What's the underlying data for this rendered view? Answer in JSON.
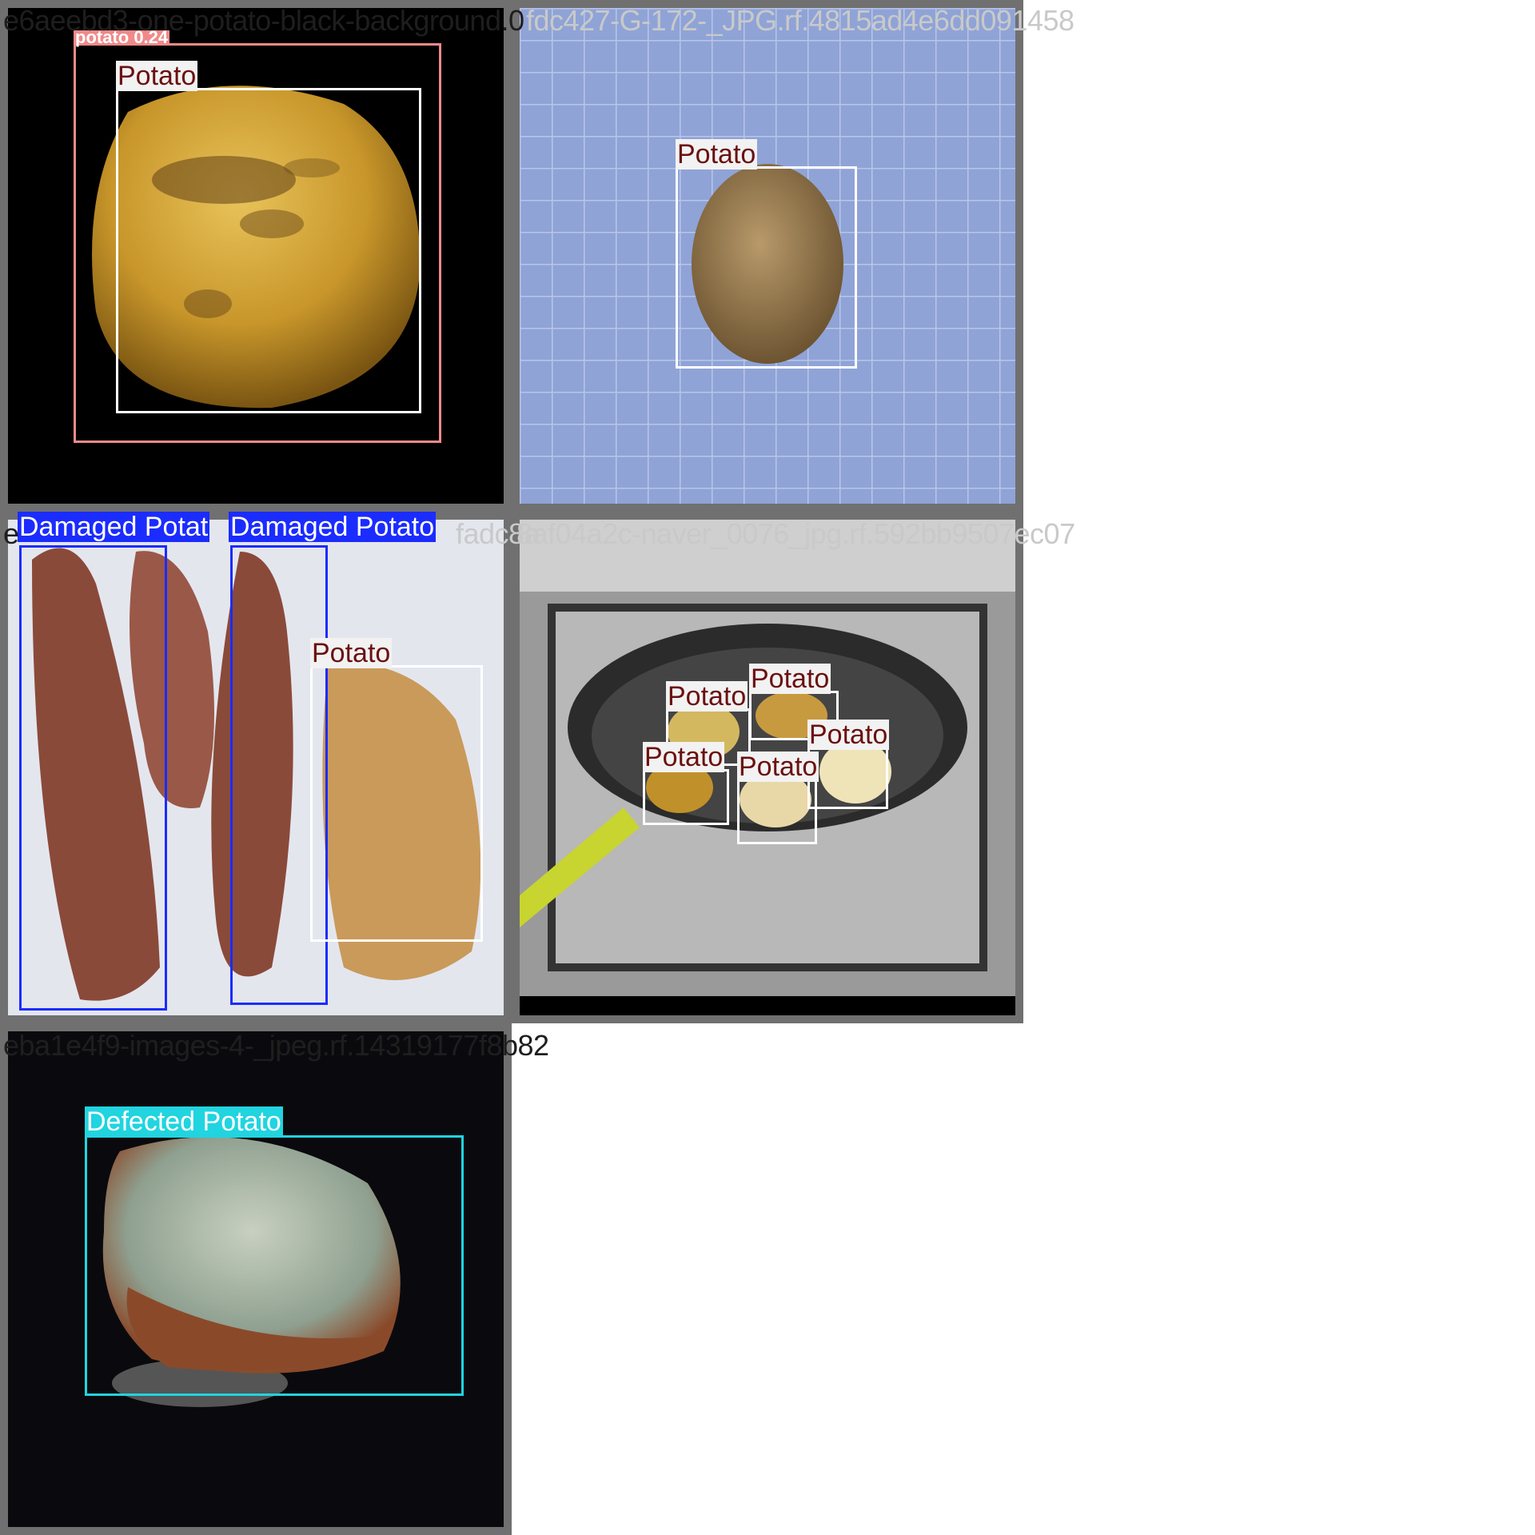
{
  "tiles": [
    {
      "filename": "e6aeebd3-one-potato-black-background.0",
      "labels": [
        "potato 0.24",
        "Potato"
      ],
      "colors": {
        "pink": "#f08a8a",
        "white": "#ffffff"
      }
    },
    {
      "filename": "fdc427-G-172-_JPG.rf.4815ad4e6dd091458",
      "labels": [
        "Potato"
      ]
    },
    {
      "filename": "e",
      "filename_tail": "fadc8a",
      "labels": [
        "Damaged Potat",
        "Damaged Potato",
        "Potato"
      ],
      "colors": {
        "blue": "#1b2cff"
      }
    },
    {
      "filename": "8af04a2c-naver_0076_jpg.rf.592bb9507ec07",
      "labels": [
        "Potato",
        "Potato",
        "Potato",
        "Potato",
        "Potato"
      ]
    },
    {
      "filename": "eba1e4f9-images-4-_jpeg.rf.14319177f8b82",
      "labels": [
        "Defected Potato"
      ],
      "colors": {
        "cyan": "#20d4e0"
      }
    }
  ]
}
